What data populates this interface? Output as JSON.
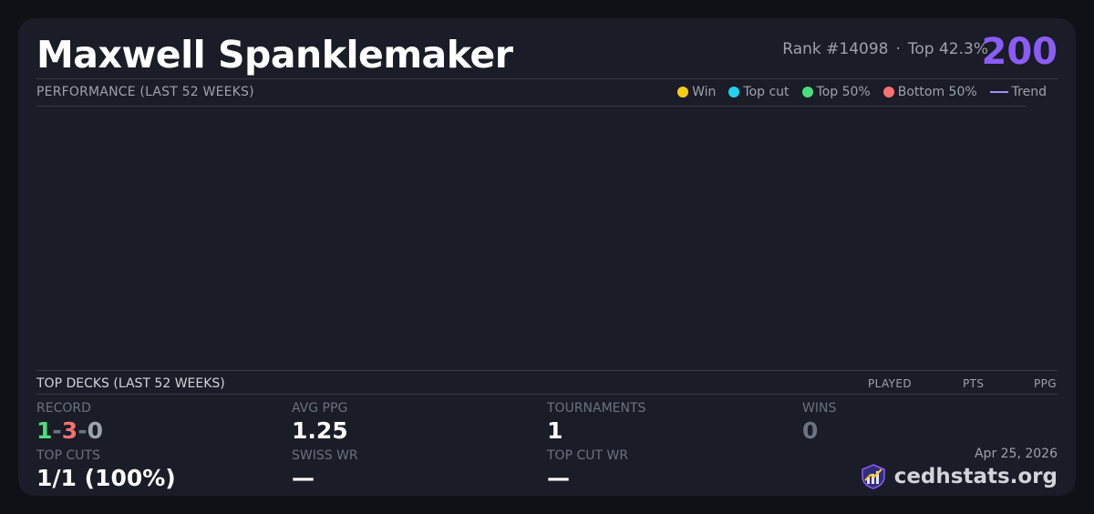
{
  "player": {
    "name": "Maxwell Spanklemaker",
    "rank": "Rank #14098",
    "separator": "·",
    "top_percent": "Top 42.3%",
    "score": "200"
  },
  "performance": {
    "title": "PERFORMANCE (LAST 52 WEEKS)",
    "legend": [
      {
        "label": "Win",
        "color": "#facc15",
        "kind": "dot"
      },
      {
        "label": "Top cut",
        "color": "#22d3ee",
        "kind": "dot"
      },
      {
        "label": "Top 50%",
        "color": "#4ade80",
        "kind": "dot"
      },
      {
        "label": "Bottom 50%",
        "color": "#f87171",
        "kind": "dot"
      },
      {
        "label": "Trend",
        "color": "#a78bfa",
        "kind": "line"
      }
    ]
  },
  "top_decks": {
    "title": "TOP DECKS (LAST 52 WEEKS)",
    "columns": [
      "PLAYED",
      "PTS",
      "PPG"
    ]
  },
  "stats": {
    "record": {
      "label": "RECORD",
      "wins": "1",
      "losses": "3",
      "draws": "0",
      "separator": "-"
    },
    "avg_ppg": {
      "label": "AVG PPG",
      "value": "1.25"
    },
    "tournaments": {
      "label": "TOURNAMENTS",
      "value": "1"
    },
    "wins": {
      "label": "WINS",
      "value": "0"
    },
    "top_cuts": {
      "label": "TOP CUTS",
      "value": "1/1 (100%)"
    },
    "swiss_wr": {
      "label": "SWISS WR",
      "value": "—"
    },
    "top_cut_wr": {
      "label": "TOP CUT WR",
      "value": "—"
    }
  },
  "footer": {
    "date": "Apr 25, 2026",
    "brand": "cedhstats.org",
    "brand_icon": "shield-chart-icon"
  }
}
